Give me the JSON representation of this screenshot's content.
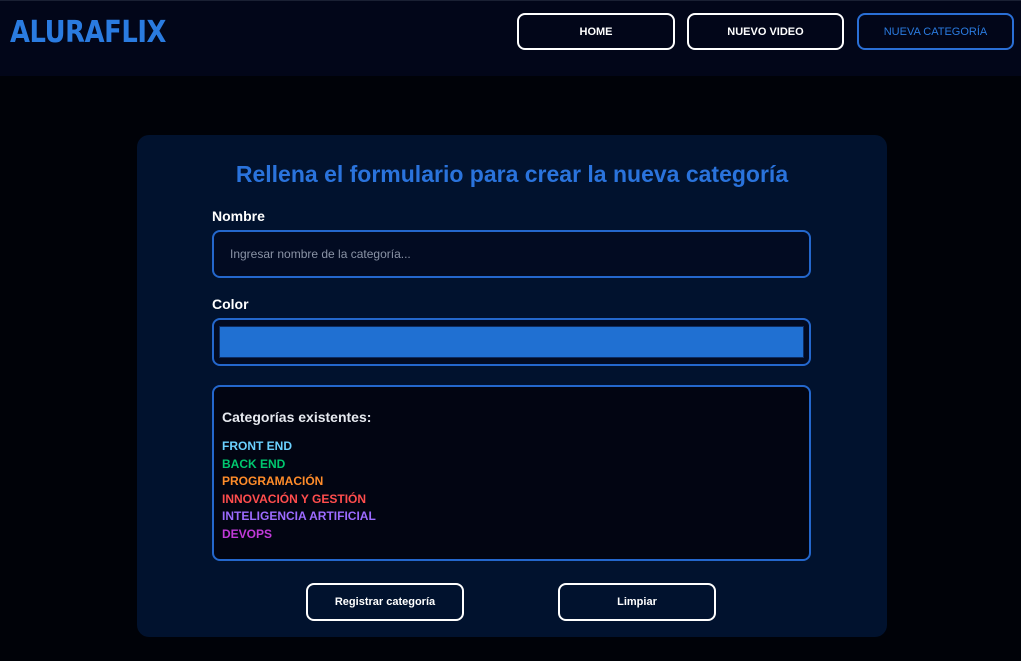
{
  "header": {
    "logo": "ALURAFLIX",
    "nav": [
      {
        "label": "HOME"
      },
      {
        "label": "NUEVO VIDEO"
      },
      {
        "label": "NUEVA CATEGORÍA"
      }
    ]
  },
  "form": {
    "title": "Rellena el formulario para crear la nueva categoría",
    "nombre_label": "Nombre",
    "nombre_placeholder": "Ingresar nombre de la categoría...",
    "nombre_value": "",
    "color_label": "Color",
    "color_value": "#2070d2",
    "existing_title": "Categorías existentes:",
    "categories": [
      {
        "name": "FRONT END",
        "color": "#6bd1ff"
      },
      {
        "name": "BACK END",
        "color": "#00c86f"
      },
      {
        "name": "PROGRAMACIÓN",
        "color": "#ff8c2a"
      },
      {
        "name": "INNOVACIÓN Y GESTIÓN",
        "color": "#ff4d4d"
      },
      {
        "name": "INTELIGENCIA ARTIFICIAL",
        "color": "#9c6bff"
      },
      {
        "name": "DEVOPS",
        "color": "#c13ad8"
      }
    ],
    "register_label": "Registrar categoría",
    "clear_label": "Limpiar"
  }
}
